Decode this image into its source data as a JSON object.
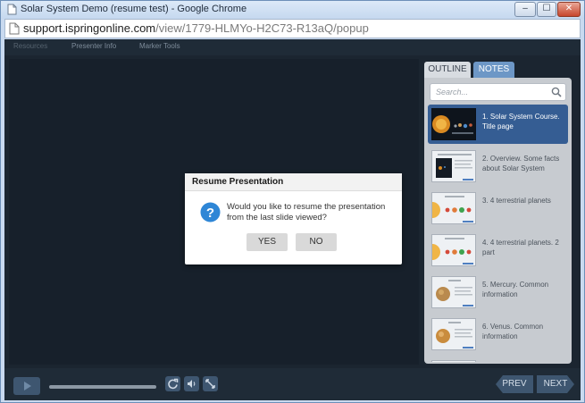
{
  "window": {
    "title": "Solar System Demo (resume test) - Google Chrome",
    "minimize_label": "–",
    "maximize_label": "☐",
    "close_label": "✕"
  },
  "address": {
    "host": "support.ispringonline.com",
    "path": "/view/1779-HLMYo-H2C73-R13aQ/popup"
  },
  "menu": {
    "items": [
      "Resources",
      "Presenter Info",
      "Marker Tools"
    ]
  },
  "sidebar": {
    "tabs": [
      {
        "label": "OUTLINE",
        "active": false
      },
      {
        "label": "NOTES",
        "active": true
      }
    ],
    "search_placeholder": "Search...",
    "slides": [
      {
        "label": "1. Solar System Course. Title page",
        "selected": true
      },
      {
        "label": "2. Overview. Some facts about Solar System",
        "selected": false
      },
      {
        "label": "3. 4 terrestrial planets",
        "selected": false
      },
      {
        "label": "4. 4 terrestrial planets. 2 part",
        "selected": false
      },
      {
        "label": "5. Mercury. Common information",
        "selected": false
      },
      {
        "label": "6. Venus. Common information",
        "selected": false
      }
    ]
  },
  "controls": {
    "prev_label": "PREV",
    "next_label": "NEXT",
    "progress": 0
  },
  "dialog": {
    "title": "Resume Presentation",
    "message": "Would you like to resume the presentation from the last slide viewed?",
    "yes_label": "YES",
    "no_label": "NO"
  },
  "colors": {
    "player_bg": "#1b2530",
    "accent": "#355d93",
    "tab_active": "#6d97c6",
    "dialog_icon": "#2e86d6"
  }
}
